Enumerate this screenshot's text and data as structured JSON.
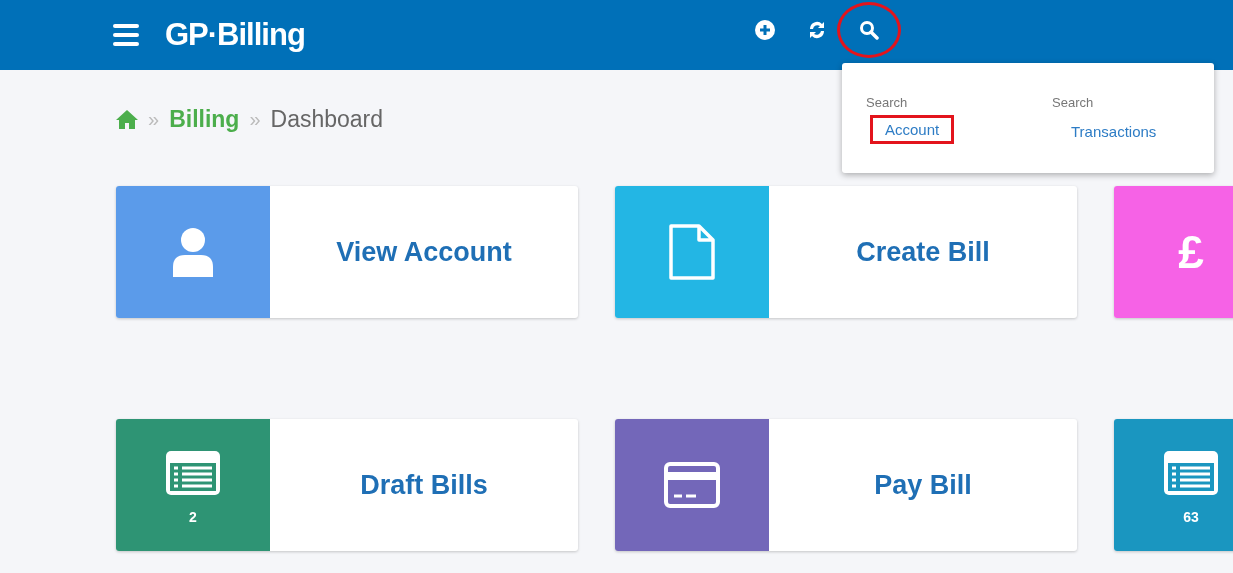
{
  "header": {
    "logo": "GP·Billing",
    "actions": [
      {
        "kind": "plus",
        "highlighted": false
      },
      {
        "kind": "sync",
        "highlighted": false
      },
      {
        "kind": "search",
        "highlighted": true
      }
    ]
  },
  "search_menu": {
    "columns": [
      {
        "heading": "Search",
        "link": "Account",
        "highlighted": true
      },
      {
        "heading": "Search",
        "link": "Transactions",
        "highlighted": false
      }
    ]
  },
  "breadcrumb": {
    "items": [
      "Billing",
      "Dashboard"
    ],
    "separator": "»"
  },
  "tiles": [
    {
      "kind": "user",
      "label": "View Account",
      "color": "#5b9bea"
    },
    {
      "kind": "file",
      "label": "Create Bill",
      "color": "#23b6e4"
    },
    {
      "kind": "glyph",
      "glyph": "£",
      "color": "#f662e6"
    },
    {
      "kind": "list",
      "label": "Draft Bills",
      "count": "2",
      "color": "#2e9474"
    },
    {
      "kind": "card",
      "label": "Pay Bill",
      "color": "#7367b9"
    },
    {
      "kind": "list",
      "count": "63",
      "color": "#1a96c0"
    }
  ]
}
